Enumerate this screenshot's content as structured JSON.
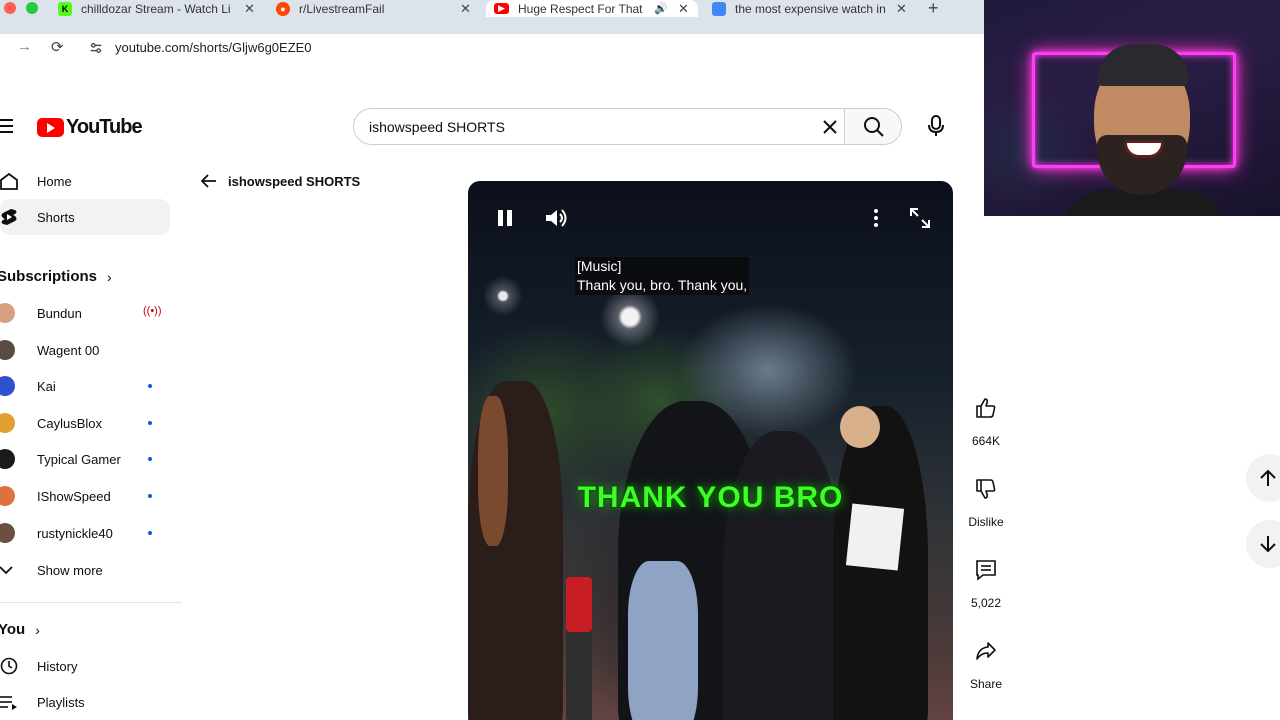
{
  "browser": {
    "tabs": [
      {
        "title": "chilldozar Stream - Watch Li",
        "favicon_color": "#53fc18",
        "favicon_glyph": "K",
        "active": false
      },
      {
        "title": "r/LivestreamFail",
        "favicon_color": "#ff4500",
        "active": false
      },
      {
        "title": "Huge Respect For That B",
        "favicon_color": "#ff0000",
        "active": true,
        "audio": true
      },
      {
        "title": "the most expensive watch in",
        "favicon_color": "#4285f4",
        "active": false
      }
    ],
    "url": "youtube.com/shorts/Gljw6g0EZE0"
  },
  "header": {
    "logo_text": "YouTube",
    "search_value": "ishowspeed SHORTS",
    "search_placeholder": "Search"
  },
  "sidebar": {
    "main": [
      {
        "label": "Home",
        "icon": "home-icon"
      },
      {
        "label": "Shorts",
        "icon": "shorts-icon"
      }
    ],
    "subscriptions_title": "Subscriptions",
    "subscriptions": [
      {
        "label": "Bundun",
        "color": "#d8a080",
        "status": "live"
      },
      {
        "label": "Wagent 00",
        "color": "#5a4a42",
        "status": ""
      },
      {
        "label": "Kai",
        "color": "#3050d0",
        "status": "new"
      },
      {
        "label": "CaylusBlox",
        "color": "#e0a030",
        "status": "new"
      },
      {
        "label": "Typical Gamer",
        "color": "#1a1a1a",
        "status": "new"
      },
      {
        "label": "IShowSpeed",
        "color": "#e07040",
        "status": "new"
      },
      {
        "label": "rustynickle40",
        "color": "#6a5040",
        "status": "new"
      }
    ],
    "show_more": "Show more",
    "you_title": "You",
    "you_items": [
      {
        "label": "History",
        "icon": "history-icon"
      },
      {
        "label": "Playlists",
        "icon": "playlists-icon"
      }
    ]
  },
  "back_link": "ishowspeed SHORTS",
  "video": {
    "caption_line1": "[Music]",
    "caption_line2": "Thank you, bro. Thank you,",
    "overlay_text": "THANK YOU BRO"
  },
  "actions": {
    "like_count": "664K",
    "dislike_label": "Dislike",
    "comment_count": "5,022",
    "share_label": "Share"
  },
  "colors": {
    "accent": "#ff0000",
    "overlay_green": "#3dff28",
    "neon_pink": "#ff3df0"
  }
}
